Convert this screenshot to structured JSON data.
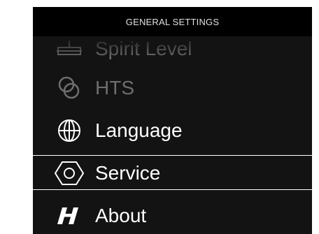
{
  "header": {
    "title": "GENERAL SETTINGS"
  },
  "menu": {
    "items": [
      {
        "label": "Spirit Level",
        "icon": "spirit-level-icon",
        "state": "partially-scrolled"
      },
      {
        "label": "HTS",
        "icon": "hts-icon",
        "state": "disabled"
      },
      {
        "label": "Language",
        "icon": "globe-icon",
        "state": "normal"
      },
      {
        "label": "Service",
        "icon": "hexagon-nut-icon",
        "state": "selected"
      },
      {
        "label": "About",
        "icon": "hasselblad-h-icon",
        "state": "normal"
      }
    ]
  },
  "colors": {
    "background": "#131313",
    "header_background": "#000000",
    "text": "#ffffff",
    "disabled_text": "#6e6e6e",
    "selection_border": "#ffffff"
  }
}
